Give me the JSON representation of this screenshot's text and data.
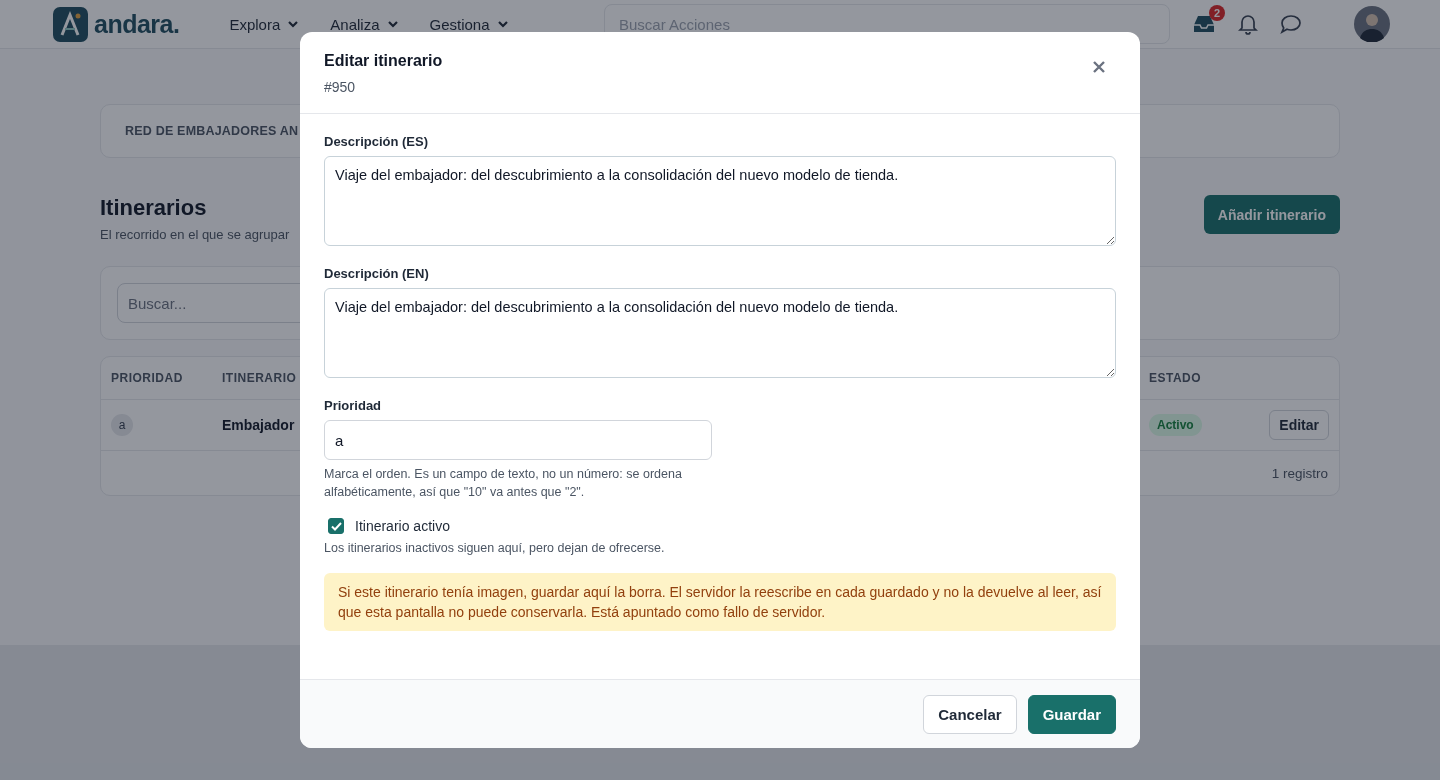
{
  "header": {
    "logo": "andara.",
    "nav": [
      {
        "label": "Explora"
      },
      {
        "label": "Analiza"
      },
      {
        "label": "Gestiona"
      }
    ],
    "search": {
      "placeholder": "Buscar Acciones"
    },
    "inbox_badge": "2"
  },
  "page": {
    "breadcrumb": "RED DE EMBAJADORES AN",
    "title": "Itinerarios",
    "subtitle": "El recorrido en el que se agrupar",
    "add_button": "Añadir itinerario",
    "search": {
      "placeholder": "Buscar..."
    },
    "table": {
      "columns": [
        "PRIORIDAD",
        "ITINERARIO",
        "ESTADO"
      ],
      "rows": [
        {
          "priority": "a",
          "name": "Embajador",
          "status": "Activo",
          "action": "Editar"
        }
      ],
      "footer": "1 registro"
    }
  },
  "modal": {
    "title": "Editar itinerario",
    "subtitle": "#950",
    "fields": [
      {
        "kind": "textarea",
        "label": "Descripción (ES)",
        "value": "Viaje del embajador: del descubrimiento a la consolidación del nuevo modelo de tienda."
      },
      {
        "kind": "textarea",
        "label": "Descripción (EN)",
        "value": "Viaje del embajador: del descubrimiento a la consolidación del nuevo modelo de tienda."
      },
      {
        "kind": "input",
        "label": "Prioridad",
        "value": "a",
        "hint": "Marca el orden. Es un campo de texto, no un número: se ordena alfabéticamente, así que \"10\" va antes que \"2\"."
      },
      {
        "kind": "checkbox",
        "label": "Itinerario activo",
        "checked": true,
        "hint": "Los itinerarios inactivos siguen aquí, pero dejan de ofrecerse."
      }
    ],
    "warning": "Si este itinerario tenía imagen, guardar aquí la borra. El servidor la reescribe en cada guardado y no la devuelve al leer, así que esta pantalla no puede conservarla. Está apuntado como fallo de servidor.",
    "buttons": [
      {
        "kind": "secondary",
        "label": "Cancelar"
      },
      {
        "kind": "primary",
        "label": "Guardar"
      }
    ]
  }
}
